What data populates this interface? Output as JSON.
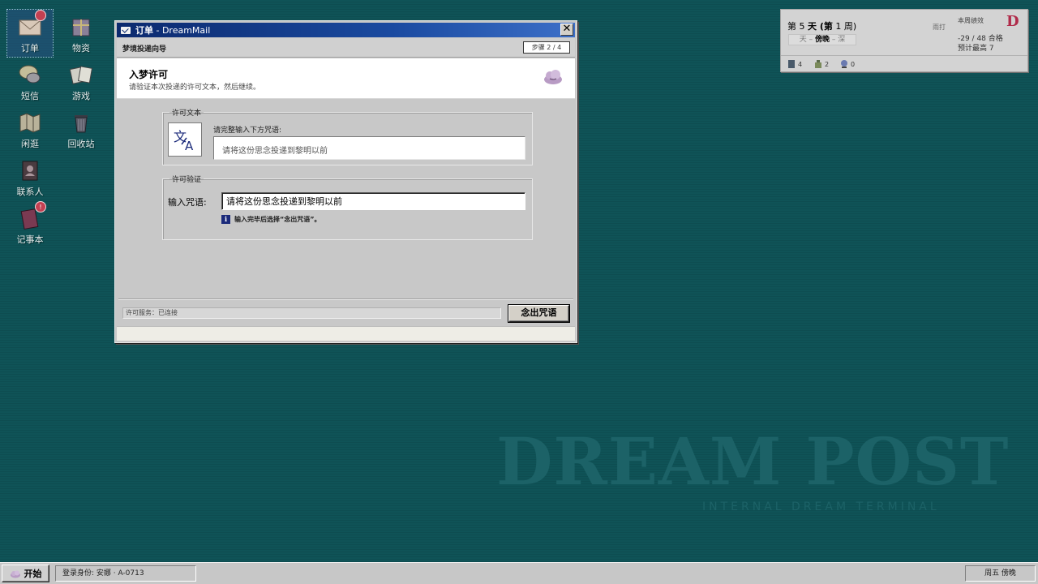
{
  "desktop": {
    "icons": [
      {
        "label": "订单",
        "badge": ""
      },
      {
        "label": "物资"
      },
      {
        "label": "短信"
      },
      {
        "label": "游戏"
      },
      {
        "label": "闲逛"
      },
      {
        "label": "回收站"
      },
      {
        "label": "联系人"
      },
      {
        "label": "记事本",
        "badge": "!"
      }
    ],
    "watermark": {
      "title": "DREAM POST",
      "subtitle": "INTERNAL DREAM TERMINAL"
    }
  },
  "status": {
    "day_prefix": "第",
    "day_num": "5",
    "day_mid": "天 (第",
    "week_num": "1",
    "day_suffix": "周)",
    "tod_prev": "天",
    "tod_current": "傍晚",
    "tod_next": "深",
    "weather": "雨打",
    "performance_label": "本周绩效",
    "grade": "D",
    "score": "-29 / 48 合格",
    "expected": "预计最高 7",
    "inventory": [
      {
        "icon": "book-icon",
        "count": "4"
      },
      {
        "icon": "bottle-icon",
        "count": "2"
      },
      {
        "icon": "crystal-ball-icon",
        "count": "0"
      }
    ]
  },
  "window": {
    "title_bold": "订单",
    "title_rest": " - DreamMail",
    "close": "✕",
    "wizard_title": "梦境投递向导",
    "step": "步骤 2 / 4",
    "header_title": "入梦许可",
    "header_sub": "请验证本次投递的许可文本，然后继续。",
    "license_group": "许可文本",
    "license_prompt": "请完整输入下方咒语:",
    "spell_text": "请将这份思念投递到黎明以前",
    "verify_group": "许可验证",
    "verify_label": "输入咒语:",
    "verify_value": "请将这份思念投递到黎明以前",
    "hint": "输入完毕后选择“念出咒语”。",
    "service_status": "许可服务：已连接",
    "cast_button": "念出咒语"
  },
  "taskbar": {
    "start": "开始",
    "login": "登录身份: 安娜 · A-0713",
    "clock": "周五 傍晚"
  }
}
